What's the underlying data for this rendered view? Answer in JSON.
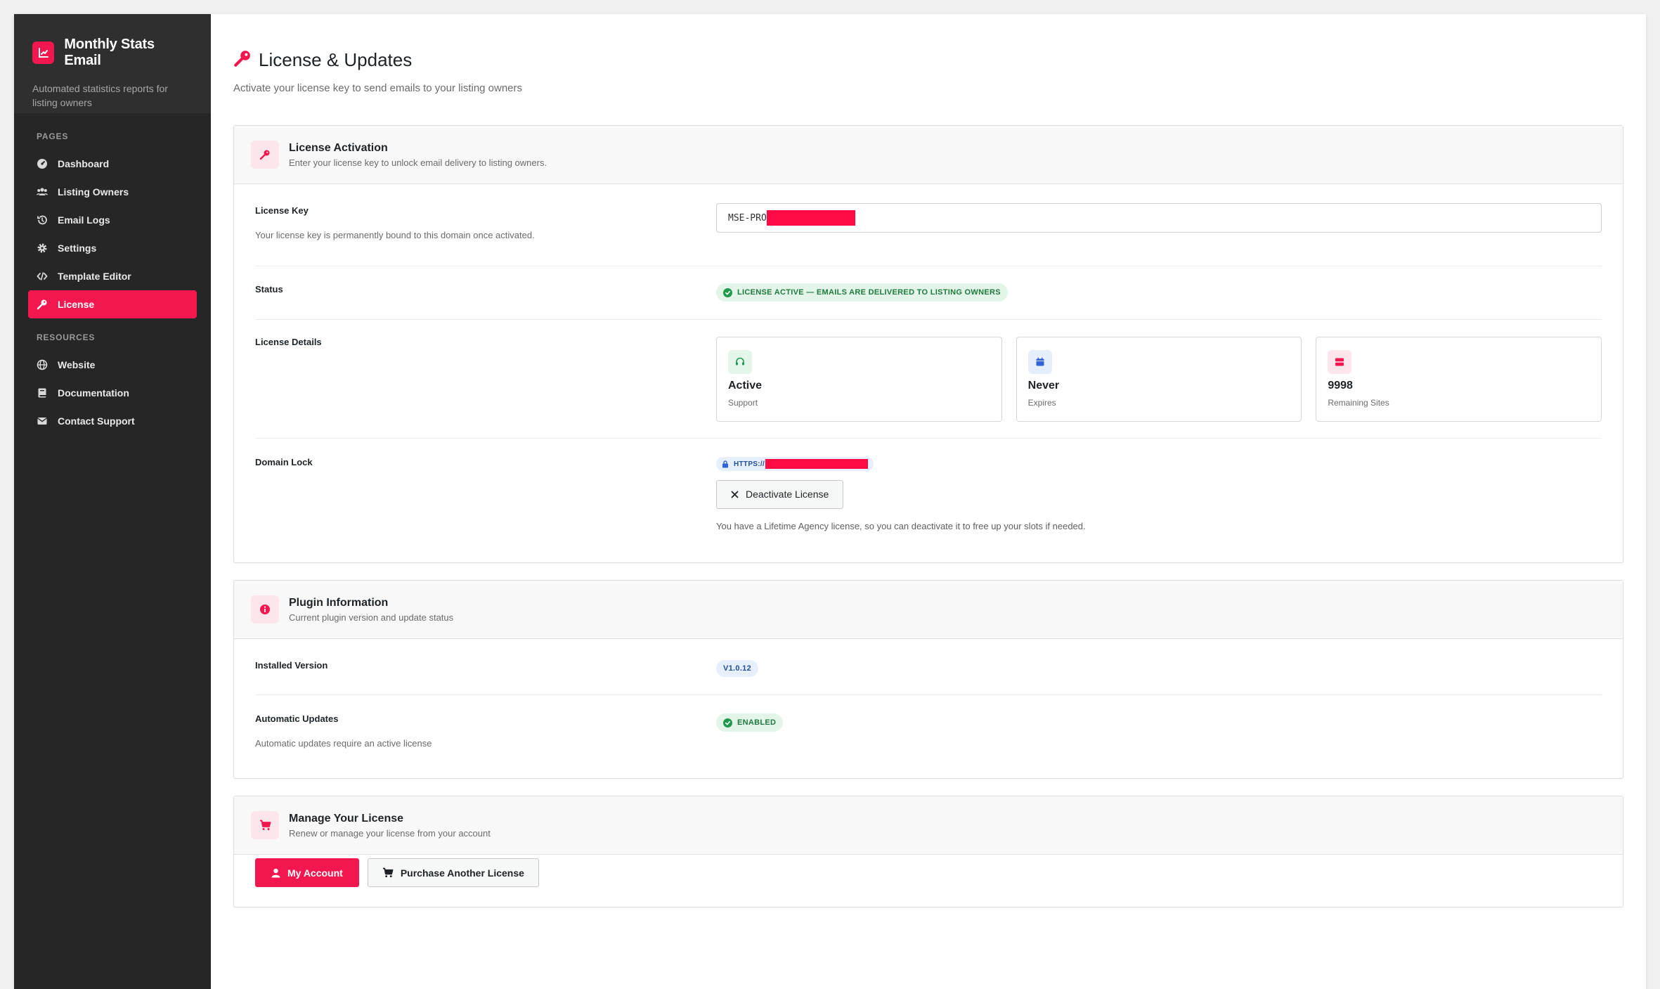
{
  "sidebar": {
    "brand_title": "Monthly Stats Email",
    "brand_subtitle": "Automated statistics reports for listing owners",
    "sections": {
      "pages_heading": "PAGES",
      "resources_heading": "RESOURCES"
    },
    "pages": [
      {
        "label": "Dashboard",
        "icon": "dashboard-icon"
      },
      {
        "label": "Listing Owners",
        "icon": "users-icon"
      },
      {
        "label": "Email Logs",
        "icon": "history-icon"
      },
      {
        "label": "Settings",
        "icon": "gear-icon"
      },
      {
        "label": "Template Editor",
        "icon": "code-icon"
      },
      {
        "label": "License",
        "icon": "key-icon",
        "active": true
      }
    ],
    "resources": [
      {
        "label": "Website",
        "icon": "globe-icon"
      },
      {
        "label": "Documentation",
        "icon": "book-icon"
      },
      {
        "label": "Contact Support",
        "icon": "envelope-icon"
      }
    ]
  },
  "page": {
    "title": "License & Updates",
    "subtitle": "Activate your license key to send emails to your listing owners"
  },
  "license_card": {
    "title": "License Activation",
    "description": "Enter your license key to unlock email delivery to listing owners.",
    "key_label": "License Key",
    "key_help": "Your license key is permanently bound to this domain once activated.",
    "key_value": "MSE-PRO",
    "status_label": "Status",
    "status_text": "LICENSE ACTIVE — EMAILS ARE DELIVERED TO LISTING OWNERS",
    "details_label": "License Details",
    "details": [
      {
        "value": "Active",
        "caption": "Support",
        "icon": "headset-icon",
        "bg": "#e4f5ea",
        "fg": "#1f9a4d"
      },
      {
        "value": "Never",
        "caption": "Expires",
        "icon": "calendar-icon",
        "bg": "#e6eefc",
        "fg": "#2f64d8"
      },
      {
        "value": "9998",
        "caption": "Remaining Sites",
        "icon": "server-icon",
        "bg": "#fde5ec",
        "fg": "#f2184f"
      }
    ],
    "domain_label": "Domain Lock",
    "domain_value": "HTTPS://",
    "deactivate_label": "Deactivate License",
    "deactivate_note": "You have a Lifetime Agency license, so you can deactivate it to free up your slots if needed."
  },
  "plugin_card": {
    "title": "Plugin Information",
    "description": "Current plugin version and update status",
    "version_label": "Installed Version",
    "version_value": "V1.0.12",
    "updates_label": "Automatic Updates",
    "updates_help": "Automatic updates require an active license",
    "updates_value": "ENABLED"
  },
  "manage_card": {
    "title": "Manage Your License",
    "description": "Renew or manage your license from your account",
    "account_button": "My Account",
    "purchase_button": "Purchase Another License"
  },
  "colors": {
    "accent": "#f2184f",
    "sidebar_bg": "#262626",
    "success": "#1f9a4d"
  }
}
